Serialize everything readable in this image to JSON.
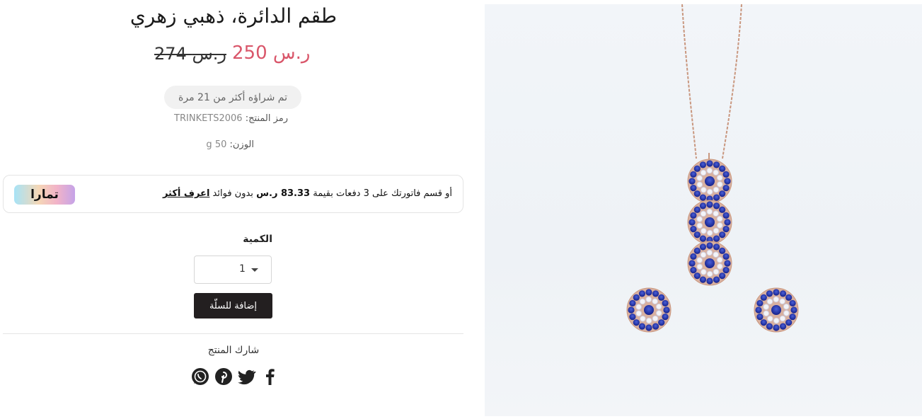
{
  "product": {
    "title": "طقم الدائرة، ذهبي زهري",
    "old_price": "274 ر.س",
    "new_price": "250 ر.س",
    "sold_badge": "تم شراؤه أكثر من 21 مرة",
    "sku_label": "رمز المنتج:",
    "sku_value": "TRINKETS2006",
    "weight_label": "الوزن:",
    "weight_value": "50 g"
  },
  "tabby": {
    "text_before": "أو قسم فاتورتك على 3 دفعات بقيمة",
    "amount": "83.33 ر.س",
    "text_after": "بدون فوائد",
    "learn_more": "اعرف أكثر",
    "logo_text": "تمارا"
  },
  "quantity": {
    "label": "الكمية",
    "value": "1"
  },
  "cart": {
    "add_label": "إضافة للسلّة"
  },
  "share": {
    "label": "شارك المنتج",
    "icons": [
      "facebook-icon",
      "twitter-icon",
      "pinterest-icon",
      "whatsapp-icon"
    ]
  },
  "colors": {
    "sale_price": "#d9566a",
    "button_bg": "#231f20",
    "stone_blue": "#1f2f9a",
    "chain_rose_gold": "#c9977f"
  }
}
